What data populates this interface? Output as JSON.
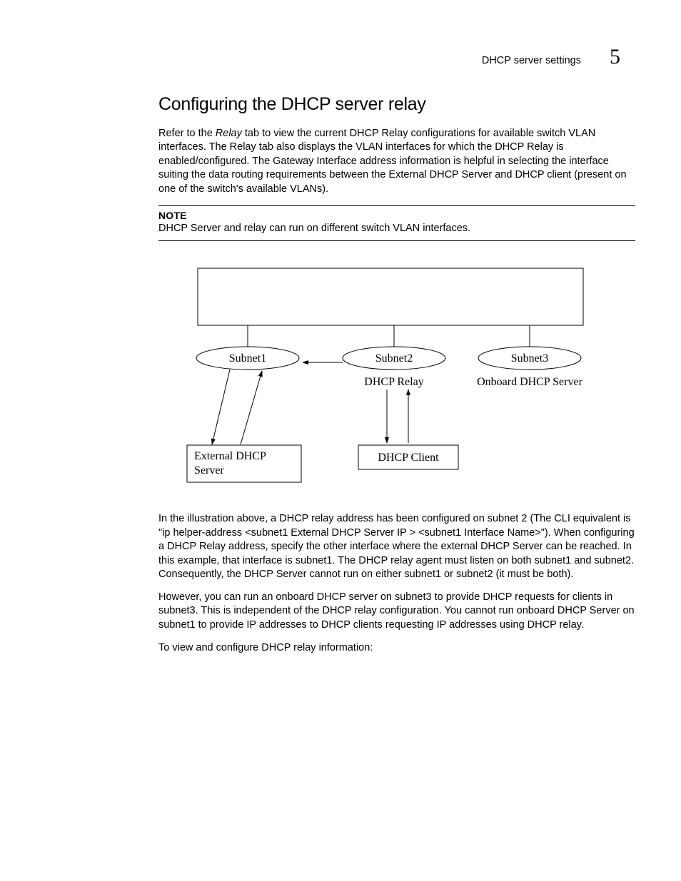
{
  "header": {
    "section": "DHCP server settings",
    "chapter": "5"
  },
  "title": "Configuring the DHCP server relay",
  "intro": "Refer to the Relay tab to view the current DHCP Relay configurations for available switch VLAN interfaces. The Relay tab also displays the VLAN interfaces for which the DHCP Relay is enabled/configured. The Gateway Interface address information is helpful in selecting the interface suiting the data routing requirements between the External DHCP Server and DHCP client (present on one of the switch's available VLANs).",
  "note": {
    "label": "NOTE",
    "text": "DHCP Server and relay can run on different switch VLAN interfaces."
  },
  "diagram": {
    "subnet1": "Subnet1",
    "subnet2": "Subnet2",
    "subnet3": "Subnet3",
    "dhcp_relay": "DHCP Relay",
    "onboard": "Onboard DHCP Server",
    "ext_server": "External DHCP\nServer",
    "dhcp_client": "DHCP Client"
  },
  "para2": "In the illustration above, a DHCP relay address has been configured on subnet 2 (The CLI equivalent is \"ip helper-address <subnet1 External DHCP Server IP > <subnet1 Interface Name>\"). When configuring a DHCP Relay address, specify the other interface where the external DHCP Server can be reached. In this example, that interface is subnet1. The DHCP relay agent must listen on both subnet1 and subnet2. Consequently, the DHCP Server cannot run on either subnet1 or subnet2 (it must be both).",
  "para3": "However, you can run an onboard DHCP server on subnet3 to provide DHCP requests for clients in subnet3. This is independent of the DHCP relay configuration. You cannot run onboard DHCP Server on subnet1 to provide IP addresses to DHCP clients requesting IP addresses using DHCP relay.",
  "para4": "To view and configure DHCP relay information:"
}
